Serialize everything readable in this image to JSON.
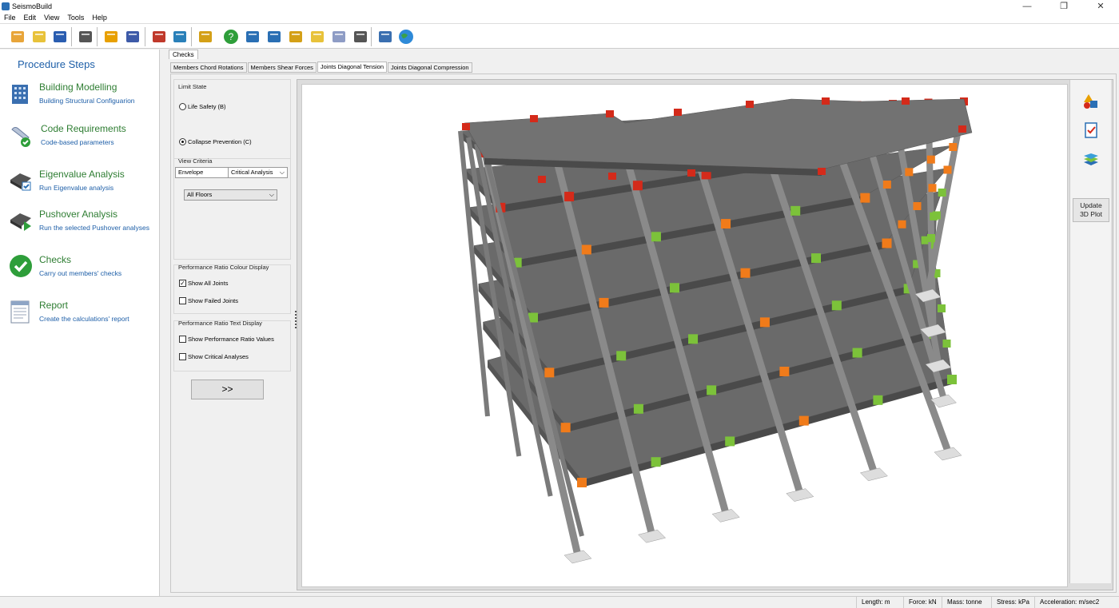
{
  "window": {
    "title": "SeismoBuild"
  },
  "menu": [
    "File",
    "Edit",
    "View",
    "Tools",
    "Help"
  ],
  "toolbar": {
    "icons": [
      "new-file-icon",
      "open-folder-icon",
      "save-icon",
      "settings-icon",
      "building-icon",
      "report-icon",
      "gear-frame-icon",
      "calculator-icon",
      "brush-icon",
      "help-icon",
      "book-icon",
      "book-open-icon",
      "folder-edit-icon",
      "folder-icon",
      "chat-icon",
      "film-icon",
      "pen-icon",
      "globe-icon"
    ],
    "colors": [
      "#e8a53a",
      "#e8c23a",
      "#2a5db0",
      "#555555",
      "#e8a000",
      "#3d5aa8",
      "#c0392b",
      "#2a80b9",
      "#d4a017",
      "#2e9e3a",
      "#2a6fb4",
      "#2a6fb4",
      "#d4a017",
      "#e8c23a",
      "#8e9cc5",
      "#555555",
      "#3a6fb0",
      "#2e8ad8"
    ]
  },
  "procedure": {
    "title": "Procedure Steps",
    "steps": [
      {
        "name": "Building Modelling",
        "desc": "Building Structural Configuarion",
        "icon": "building-grid-icon"
      },
      {
        "name": "Code Requirements",
        "desc": "Code-based parameters",
        "icon": "scroll-check-icon"
      },
      {
        "name": "Eigenvalue Analysis",
        "desc": "Run Eigenvalue analysis",
        "icon": "machine-check-icon"
      },
      {
        "name": "Pushover Analysis",
        "desc": "Run the selected Pushover analyses",
        "icon": "machine-play-icon"
      },
      {
        "name": "Checks",
        "desc": "Carry out members' checks",
        "icon": "green-check-icon"
      },
      {
        "name": "Report",
        "desc": "Create the calculations' report",
        "icon": "document-icon"
      }
    ]
  },
  "main": {
    "outer_tab": "Checks",
    "tabs": [
      "Members Chord Rotations",
      "Members Shear Forces",
      "Joints Diagonal Tension",
      "Joints Diagonal Compression"
    ],
    "active_tab": 2
  },
  "controls": {
    "limit_state": {
      "label": "Limit State",
      "life_safety": "Life Safety (B)",
      "collapse_prevention": "Collapse Prevention (C)"
    },
    "view_criteria": {
      "label": "View Criteria",
      "envelope": "Envelope",
      "critical": "Critical Analysis",
      "floors": "All Floors"
    },
    "colour_display": {
      "label": "Performance Ratio Colour Display",
      "show_all": "Show All Joints",
      "show_failed": "Show Failed Joints"
    },
    "text_display": {
      "label": "Performance Ratio Text Display",
      "show_values": "Show Performance Ratio Values",
      "show_critical": "Show Critical Analyses"
    },
    "next": ">>"
  },
  "right_tools": {
    "update_label_1": "Update",
    "update_label_2": "3D Plot"
  },
  "model_colors": {
    "slab": "#6a6a6a",
    "column": "#8a8a8a",
    "red": "#d42a1a",
    "orange": "#f07b1a",
    "green": "#7cc23a"
  },
  "status": {
    "length": "Length: m",
    "force": "Force: kN",
    "mass": "Mass: tonne",
    "stress": "Stress: kPa",
    "accel": "Acceleration: m/sec2"
  }
}
